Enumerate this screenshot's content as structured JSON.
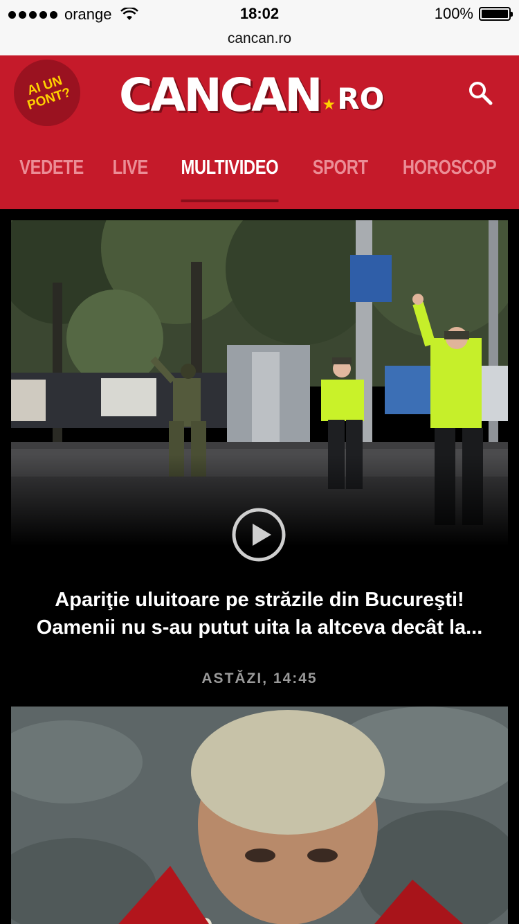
{
  "status_bar": {
    "carrier": "orange",
    "time": "18:02",
    "battery": "100%",
    "battery_level": 1.0
  },
  "browser": {
    "url": "cancan.ro"
  },
  "header": {
    "pont_badge": "AI UN PONT?",
    "logo_main": "CANCAN",
    "logo_suffix": "RO",
    "brand_color": "#c51a2a",
    "search_icon": "search-icon"
  },
  "nav": {
    "items": [
      "VEDETE",
      "LIVE",
      "MULTIVIDEO",
      "SPORT",
      "HOROSCOP"
    ],
    "active": "MULTIVIDEO"
  },
  "feed": {
    "articles": [
      {
        "headline": "Apariţie uluitoare pe străzile din Bucureşti! Oamenii nu s-au putut uita la altceva decât la...",
        "date": "ASTĂZI, 14:45",
        "media": "play-icon"
      }
    ]
  }
}
